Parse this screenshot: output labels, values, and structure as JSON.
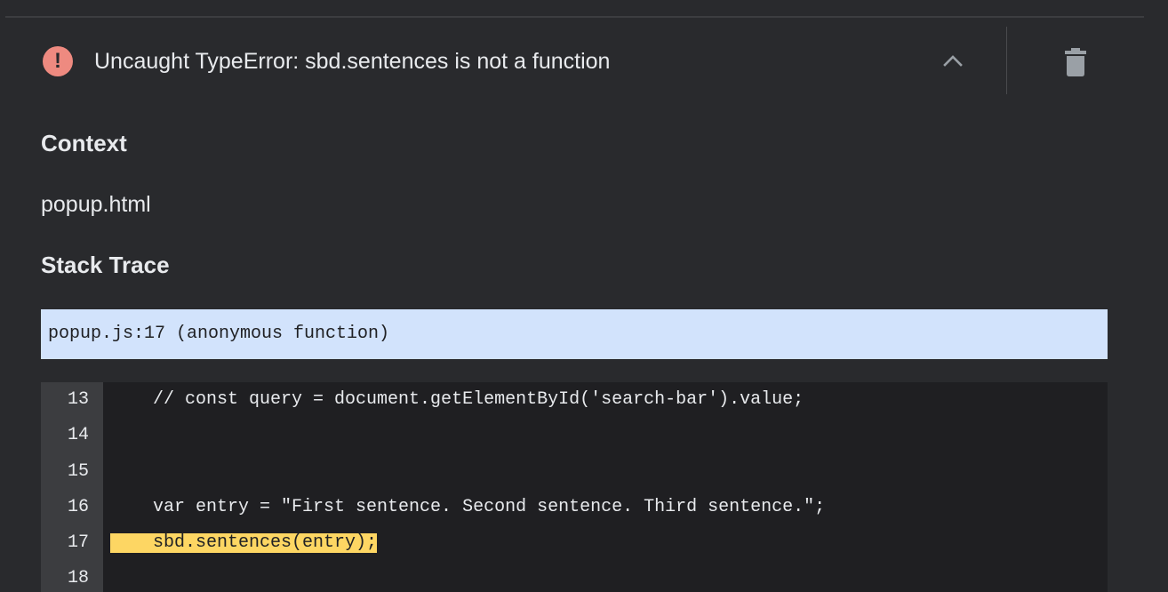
{
  "error": {
    "icon": "error-icon",
    "icon_glyph": "!",
    "icon_color": "#ee8a80",
    "title": "Uncaught TypeError: sbd.sentences is not a function",
    "collapse_icon": "chevron-up-icon",
    "delete_icon": "trash-icon"
  },
  "context": {
    "heading": "Context",
    "value": "popup.html"
  },
  "stack_trace": {
    "heading": "Stack Trace",
    "frames": [
      {
        "label": "popup.js:17 (anonymous function)"
      }
    ],
    "highlight_color": "#d2e3fc"
  },
  "source": {
    "highlight_color": "#fdd663",
    "lines": [
      {
        "number": "13",
        "code": "    // const query = document.getElementById('search-bar').value;",
        "highlighted": false
      },
      {
        "number": "14",
        "code": "",
        "highlighted": false
      },
      {
        "number": "15",
        "code": "",
        "highlighted": false
      },
      {
        "number": "16",
        "code": "    var entry = \"First sentence. Second sentence. Third sentence.\";",
        "highlighted": false
      },
      {
        "number": "17",
        "code": "    sbd.sentences(entry);",
        "highlighted": true
      },
      {
        "number": "18",
        "code": "",
        "highlighted": false
      }
    ]
  }
}
